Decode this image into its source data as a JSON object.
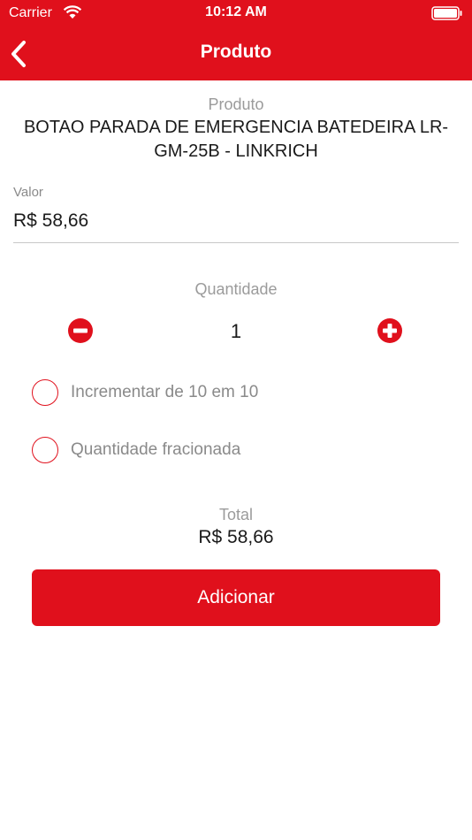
{
  "status_bar": {
    "carrier": "Carrier",
    "time": "10:12 AM"
  },
  "nav": {
    "title": "Produto"
  },
  "product": {
    "label": "Produto",
    "name": "BOTAO PARADA DE EMERGENCIA BATEDEIRA LR-GM-25B - LINKRICH"
  },
  "valor": {
    "label": "Valor",
    "value": "R$ 58,66"
  },
  "quantity": {
    "label": "Quantidade",
    "value": "1"
  },
  "options": [
    {
      "label": "Incrementar de 10 em 10",
      "checked": false
    },
    {
      "label": "Quantidade fracionada",
      "checked": false
    }
  ],
  "total": {
    "label": "Total",
    "value": "R$ 58,66"
  },
  "add_button": {
    "label": "Adicionar"
  },
  "colors": {
    "accent": "#e0101c",
    "muted_text": "#9b9b9b",
    "text": "#1a1a1a"
  }
}
